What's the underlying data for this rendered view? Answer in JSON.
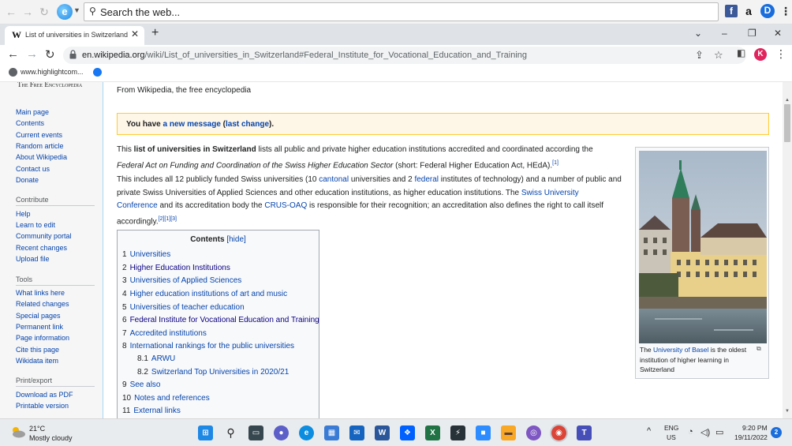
{
  "toolbar": {
    "search_placeholder": "Search the web...",
    "amazon_label": "a",
    "d_label": "D",
    "menu_label": "⋮"
  },
  "tab": {
    "favicon": "W",
    "title": "List of universities in Switzerland",
    "close": "✕",
    "new_tab": "+"
  },
  "window": {
    "chevron": "⌄",
    "minimize": "–",
    "restore": "❐",
    "close": "✕"
  },
  "address": {
    "url_host": "en.wikipedia.org",
    "url_path": "/wiki/List_of_universities_in_Switzerland#Federal_Institute_for_Vocational_Education_and_Training",
    "profile_initial": "K"
  },
  "bookmarks": [
    {
      "label": "www.highlightcom...",
      "color": "#5f6368"
    },
    {
      "label": "",
      "color": "#1877f2"
    }
  ],
  "sidebar": {
    "tagline": "The Free Encyclopedia",
    "main": [
      "Main page",
      "Contents",
      "Current events",
      "Random article",
      "About Wikipedia",
      "Contact us",
      "Donate"
    ],
    "contribute_heading": "Contribute",
    "contribute": [
      "Help",
      "Learn to edit",
      "Community portal",
      "Recent changes",
      "Upload file"
    ],
    "tools_heading": "Tools",
    "tools": [
      "What links here",
      "Related changes",
      "Special pages",
      "Permanent link",
      "Page information",
      "Cite this page",
      "Wikidata item"
    ],
    "print_heading": "Print/export",
    "print": [
      "Download as PDF",
      "Printable version"
    ]
  },
  "article": {
    "from": "From Wikipedia, the free encyclopedia",
    "message": {
      "pre": "You have ",
      "link1": "a new message",
      "mid": " (",
      "link2": "last change",
      "post": ")."
    },
    "p1": {
      "t1": "This ",
      "bold": "list of universities in Switzerland",
      "t2": " lists all public and private higher education institutions accredited and coordinated according the ",
      "italic": "Federal Act on Funding and Coordination of the Swiss Higher Education Sector",
      "t3": " (short: Federal Higher Education Act, HEdA).",
      "ref": "[1]"
    },
    "p2": {
      "t1": "This includes all 12 publicly funded Swiss universities (10 ",
      "l1": "cantonal",
      "t2": " universities and 2 ",
      "l2": "federal",
      "t3": " institutes of technology) and a number of public and private Swiss Universities of Applied Sciences and other education institutions, as higher education institutions. The ",
      "l3": "Swiss University Conference",
      "t4": " and its accreditation body the ",
      "l4": "CRUS-OAQ",
      "t5": " is responsible for their recognition; an accreditation also defines the right to call itself accordingly.",
      "ref": "[2][1][3]"
    },
    "toc": {
      "title": "Contents",
      "hide": "[hide]",
      "items": [
        {
          "num": "1",
          "label": "Universities"
        },
        {
          "num": "2",
          "label": "Higher Education Institutions"
        },
        {
          "num": "3",
          "label": "Universities of Applied Sciences"
        },
        {
          "num": "4",
          "label": "Higher education institutions of art and music"
        },
        {
          "num": "5",
          "label": "Universities of teacher education"
        },
        {
          "num": "6",
          "label": "Federal Institute for Vocational Education and Training"
        },
        {
          "num": "7",
          "label": "Accredited institutions"
        },
        {
          "num": "8",
          "label": "International rankings for the public universities"
        },
        {
          "num": "8.1",
          "label": "ARWU"
        },
        {
          "num": "8.2",
          "label": "Switzerland Top Universities in 2020/21"
        },
        {
          "num": "9",
          "label": "See also"
        },
        {
          "num": "10",
          "label": "Notes and references"
        },
        {
          "num": "11",
          "label": "External links"
        }
      ]
    },
    "thumb": {
      "pre": "The ",
      "link": "University of Basel",
      "post": " is the oldest institution of higher learning in Switzerland"
    }
  },
  "taskbar": {
    "temp": "21°C",
    "condition": "Mostly cloudy",
    "lang1": "ENG",
    "lang2": "US",
    "time": "9:20 PM",
    "date": "19/11/2022",
    "notifications": "2",
    "apps": [
      {
        "name": "windows",
        "color": "#1e88e5",
        "glyph": "⊞"
      },
      {
        "name": "search",
        "color": "#e9ecef",
        "glyph": "⚲"
      },
      {
        "name": "task-view",
        "color": "#37474f",
        "glyph": "▭"
      },
      {
        "name": "teams",
        "color": "#5b5fc7",
        "glyph": "●"
      },
      {
        "name": "edge",
        "color": "#0c8de0",
        "glyph": "e"
      },
      {
        "name": "store",
        "color": "#3a7bd5",
        "glyph": "▦"
      },
      {
        "name": "mail",
        "color": "#1565c0",
        "glyph": "✉"
      },
      {
        "name": "word",
        "color": "#2b579a",
        "glyph": "W"
      },
      {
        "name": "dropbox",
        "color": "#0061ff",
        "glyph": "❖"
      },
      {
        "name": "excel",
        "color": "#217346",
        "glyph": "X"
      },
      {
        "name": "vpn",
        "color": "#263238",
        "glyph": "⚡"
      },
      {
        "name": "camera",
        "color": "#2d8cff",
        "glyph": "■"
      },
      {
        "name": "folder",
        "color": "#f9a825",
        "glyph": "▬"
      },
      {
        "name": "tor",
        "color": "#7e57c2",
        "glyph": "◎"
      },
      {
        "name": "chrome",
        "color": "#db4437",
        "glyph": "◉"
      },
      {
        "name": "teams-classic",
        "color": "#464eb8",
        "glyph": "T"
      }
    ]
  }
}
